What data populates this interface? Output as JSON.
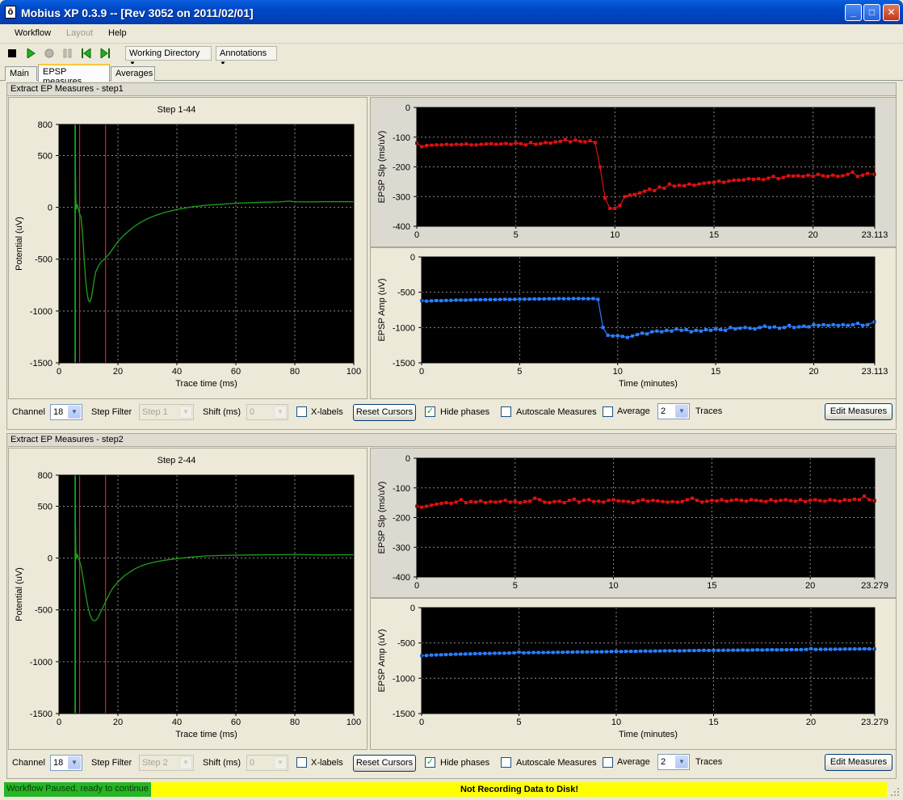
{
  "window": {
    "title": "Mobius XP 0.3.9 -- [Rev 3052 on 2011/02/01]",
    "icon": "app-logo-icon",
    "buttons": [
      "minimize-icon",
      "maximize-icon",
      "close-icon"
    ]
  },
  "menu": {
    "items": [
      "Workflow",
      "Layout",
      "Help"
    ],
    "disabled": [
      "Layout"
    ]
  },
  "toolbar": {
    "icons": [
      "stop-icon",
      "play-icon",
      "record-icon",
      "pause-icon",
      "step-back-icon",
      "step-forward-icon"
    ],
    "working_directory": "Working Directory",
    "annotations": "Annotations"
  },
  "tabs": [
    "Main",
    "EPSP measures",
    "Averages"
  ],
  "active_tab": "EPSP measures",
  "panels": [
    {
      "header": "Extract EP Measures - step1",
      "trace_title": "Step 1-44",
      "controls": {
        "channel_label": "Channel",
        "channel_value": "18",
        "step_filter_label": "Step Filter",
        "step_filter_value": "Step 1",
        "shift_label": "Shift (ms)",
        "shift_value": "0",
        "xlabels_label": "X-labels",
        "xlabels_checked": false,
        "reset_cursors": "Reset Cursors",
        "hide_phases_label": "Hide phases",
        "hide_phases_checked": true,
        "autoscale_label": "Autoscale Measures",
        "autoscale_checked": false,
        "average_label": "Average",
        "average_checked": false,
        "average_value": "2",
        "traces_label": "Traces",
        "edit_measures": "Edit Measures"
      }
    },
    {
      "header": "Extract EP Measures - step2",
      "trace_title": "Step 2-44",
      "controls": {
        "channel_label": "Channel",
        "channel_value": "18",
        "step_filter_label": "Step Filter",
        "step_filter_value": "Step 2",
        "shift_label": "Shift (ms)",
        "shift_value": "0",
        "xlabels_label": "X-labels",
        "xlabels_checked": false,
        "reset_cursors": "Reset Cursors",
        "hide_phases_label": "Hide phases",
        "hide_phases_checked": true,
        "autoscale_label": "Autoscale Measures",
        "autoscale_checked": false,
        "average_label": "Average",
        "average_checked": false,
        "average_value": "2",
        "traces_label": "Traces",
        "edit_measures": "Edit Measures"
      }
    }
  ],
  "status": {
    "left": "Workflow Paused, ready to continue",
    "right": "Not Recording Data to Disk!"
  },
  "colors": {
    "plot_bg": "#000000",
    "trace": "#1ea01e",
    "cursor_green": "#20c020",
    "cursor_red": "#e02020",
    "slope_series": "#e01010",
    "amp_series": "#2a7fff",
    "status_ok": "#26b524",
    "status_warn": "#ffff00"
  },
  "chart_data": [
    {
      "id": "trace1",
      "type": "line",
      "ylabel": "Potential (uV)",
      "xlabel": "Trace time (ms)",
      "xlim": [
        0,
        100
      ],
      "ylim": [
        -1500,
        800
      ],
      "xticks": [
        "0",
        "20",
        "40",
        "60",
        "80",
        "100"
      ],
      "yticks": [
        "800",
        "500",
        "0",
        "-500",
        "-1000",
        "-1500"
      ],
      "cursors_green": [
        5.5
      ],
      "cursors_red": [
        7,
        15.8
      ],
      "x": [
        5.5,
        5.6,
        5.7,
        5.9,
        6.2,
        6.6,
        7,
        7.5,
        8,
        8.5,
        9,
        9.5,
        10,
        10.5,
        11,
        11.5,
        12,
        12.5,
        13,
        13.5,
        14,
        14.5,
        15,
        15.5,
        16,
        17,
        18,
        19,
        20,
        22,
        24,
        26,
        28,
        30,
        33,
        36,
        40,
        45,
        50,
        55,
        60,
        65,
        70,
        75,
        78,
        80,
        85,
        90,
        95,
        100
      ],
      "y": [
        0,
        380,
        100,
        -20,
        30,
        -20,
        -60,
        -100,
        -250,
        -480,
        -680,
        -820,
        -900,
        -910,
        -870,
        -780,
        -690,
        -620,
        -590,
        -560,
        -540,
        -520,
        -510,
        -500,
        -480,
        -450,
        -410,
        -370,
        -330,
        -270,
        -220,
        -175,
        -140,
        -110,
        -75,
        -48,
        -20,
        5,
        20,
        30,
        40,
        45,
        50,
        52,
        60,
        55,
        52,
        55,
        55,
        55
      ]
    },
    {
      "id": "slope1",
      "type": "line",
      "ylabel": "EPSP Slp (ms/uV)",
      "xlabel": "",
      "xlim": [
        0,
        23.113
      ],
      "ylim": [
        -400,
        0
      ],
      "xticks": [
        "0",
        "5",
        "10",
        "15",
        "20",
        "23.113"
      ],
      "yticks": [
        "0",
        "-100",
        "-200",
        "-300",
        "-400"
      ],
      "x": [
        0,
        0.25,
        0.5,
        0.75,
        1,
        1.25,
        1.5,
        1.75,
        2,
        2.25,
        2.5,
        2.75,
        3,
        3.25,
        3.5,
        3.75,
        4,
        4.25,
        4.5,
        4.75,
        5,
        5.25,
        5.5,
        5.75,
        6,
        6.25,
        6.5,
        6.75,
        7,
        7.25,
        7.5,
        7.75,
        8,
        8.25,
        8.5,
        8.75,
        9,
        9.25,
        9.5,
        9.75,
        10,
        10.25,
        10.5,
        10.75,
        11,
        11.25,
        11.5,
        11.75,
        12,
        12.25,
        12.5,
        12.75,
        13,
        13.25,
        13.5,
        13.75,
        14,
        14.25,
        14.5,
        14.75,
        15,
        15.25,
        15.5,
        15.75,
        16,
        16.25,
        16.5,
        16.75,
        17,
        17.25,
        17.5,
        17.75,
        18,
        18.25,
        18.5,
        18.75,
        19,
        19.25,
        19.5,
        19.75,
        20,
        20.25,
        20.5,
        20.75,
        21,
        21.25,
        21.5,
        21.75,
        22,
        22.25,
        22.5,
        22.75,
        23.1
      ],
      "y": [
        -120,
        -132,
        -128,
        -127,
        -126,
        -126,
        -124,
        -126,
        -124,
        -125,
        -123,
        -126,
        -126,
        -124,
        -123,
        -122,
        -124,
        -123,
        -121,
        -124,
        -120,
        -122,
        -126,
        -118,
        -124,
        -122,
        -118,
        -120,
        -116,
        -114,
        -108,
        -116,
        -110,
        -114,
        -116,
        -112,
        -118,
        -200,
        -305,
        -340,
        -340,
        -330,
        -300,
        -295,
        -293,
        -288,
        -282,
        -275,
        -280,
        -268,
        -272,
        -258,
        -265,
        -262,
        -264,
        -258,
        -262,
        -258,
        -255,
        -253,
        -252,
        -248,
        -252,
        -248,
        -245,
        -245,
        -244,
        -240,
        -242,
        -240,
        -243,
        -238,
        -232,
        -240,
        -236,
        -230,
        -231,
        -230,
        -232,
        -228,
        -232,
        -225,
        -230,
        -232,
        -228,
        -232,
        -230,
        -225,
        -218,
        -232,
        -228,
        -222,
        -225
      ]
    },
    {
      "id": "amp1",
      "type": "line",
      "ylabel": "EPSP Amp (uV)",
      "xlabel": "Time (minutes)",
      "xlim": [
        0,
        23.113
      ],
      "ylim": [
        -1500,
        0
      ],
      "xticks": [
        "0",
        "5",
        "10",
        "15",
        "20",
        "23.113"
      ],
      "yticks": [
        "0",
        "-500",
        "-1000",
        "-1500"
      ],
      "x": [
        0,
        0.25,
        0.5,
        0.75,
        1,
        1.25,
        1.5,
        1.75,
        2,
        2.25,
        2.5,
        2.75,
        3,
        3.25,
        3.5,
        3.75,
        4,
        4.25,
        4.5,
        4.75,
        5,
        5.25,
        5.5,
        5.75,
        6,
        6.25,
        6.5,
        6.75,
        7,
        7.25,
        7.5,
        7.75,
        8,
        8.25,
        8.5,
        8.75,
        9,
        9.25,
        9.5,
        9.75,
        10,
        10.25,
        10.5,
        10.75,
        11,
        11.25,
        11.5,
        11.75,
        12,
        12.25,
        12.5,
        12.75,
        13,
        13.25,
        13.5,
        13.75,
        14,
        14.25,
        14.5,
        14.75,
        15,
        15.25,
        15.5,
        15.75,
        16,
        16.25,
        16.5,
        16.75,
        17,
        17.25,
        17.5,
        17.75,
        18,
        18.25,
        18.5,
        18.75,
        19,
        19.25,
        19.5,
        19.75,
        20,
        20.25,
        20.5,
        20.75,
        21,
        21.25,
        21.5,
        21.75,
        22,
        22.25,
        22.5,
        22.75,
        23.1
      ],
      "y": [
        -620,
        -625,
        -622,
        -618,
        -620,
        -616,
        -615,
        -612,
        -610,
        -612,
        -608,
        -606,
        -606,
        -605,
        -604,
        -603,
        -602,
        -600,
        -601,
        -600,
        -598,
        -598,
        -596,
        -595,
        -595,
        -594,
        -592,
        -593,
        -590,
        -592,
        -592,
        -590,
        -590,
        -591,
        -592,
        -590,
        -600,
        -1000,
        -1110,
        -1120,
        -1115,
        -1125,
        -1140,
        -1120,
        -1100,
        -1080,
        -1090,
        -1060,
        -1050,
        -1060,
        -1040,
        -1050,
        -1020,
        -1040,
        -1030,
        -1060,
        -1040,
        -1050,
        -1030,
        -1040,
        -1020,
        -1030,
        -1040,
        -1000,
        -1020,
        -1010,
        -1000,
        -1010,
        -1020,
        -1000,
        -980,
        -1000,
        -990,
        -1010,
        -1000,
        -970,
        -1000,
        -990,
        -980,
        -990,
        -960,
        -970,
        -960,
        -970,
        -960,
        -970,
        -960,
        -970,
        -960,
        -940,
        -970,
        -960,
        -920
      ]
    },
    {
      "id": "trace2",
      "type": "line",
      "ylabel": "Potential (uV)",
      "xlabel": "Trace time (ms)",
      "xlim": [
        0,
        100
      ],
      "ylim": [
        -1500,
        800
      ],
      "xticks": [
        "0",
        "20",
        "40",
        "60",
        "80",
        "100"
      ],
      "yticks": [
        "800",
        "500",
        "0",
        "-500",
        "-1000",
        "-1500"
      ],
      "cursors_green": [
        5.5
      ],
      "cursors_red": [
        7,
        15.8
      ],
      "x": [
        5.5,
        5.6,
        5.7,
        5.9,
        6.2,
        6.6,
        7,
        7.5,
        8,
        8.5,
        9,
        9.5,
        10,
        10.5,
        11,
        11.5,
        12,
        12.5,
        13,
        13.5,
        14,
        15,
        16,
        17,
        18,
        20,
        22,
        24,
        26,
        28,
        30,
        33,
        36,
        40,
        45,
        50,
        55,
        60,
        65,
        70,
        75,
        80,
        85,
        90,
        95,
        100
      ],
      "y": [
        0,
        350,
        90,
        -10,
        40,
        0,
        -30,
        -80,
        -160,
        -250,
        -340,
        -420,
        -490,
        -545,
        -580,
        -600,
        -605,
        -600,
        -585,
        -560,
        -530,
        -470,
        -410,
        -350,
        -300,
        -230,
        -175,
        -135,
        -100,
        -75,
        -55,
        -35,
        -20,
        -5,
        10,
        20,
        25,
        28,
        30,
        32,
        32,
        35,
        32,
        30,
        32,
        32
      ]
    },
    {
      "id": "slope2",
      "type": "line",
      "ylabel": "EPSP Slp (ms/uV)",
      "xlabel": "",
      "xlim": [
        0,
        23.279
      ],
      "ylim": [
        -400,
        0
      ],
      "xticks": [
        "0",
        "5",
        "10",
        "15",
        "20",
        "23.279"
      ],
      "yticks": [
        "0",
        "-100",
        "-200",
        "-300",
        "-400"
      ],
      "x": [
        0,
        0.25,
        0.5,
        0.75,
        1,
        1.25,
        1.5,
        1.75,
        2,
        2.25,
        2.5,
        2.75,
        3,
        3.25,
        3.5,
        3.75,
        4,
        4.25,
        4.5,
        4.75,
        5,
        5.25,
        5.5,
        5.75,
        6,
        6.25,
        6.5,
        6.75,
        7,
        7.25,
        7.5,
        7.75,
        8,
        8.25,
        8.5,
        8.75,
        9,
        9.25,
        9.5,
        9.75,
        10,
        10.25,
        10.5,
        10.75,
        11,
        11.25,
        11.5,
        11.75,
        12,
        12.25,
        12.5,
        12.75,
        13,
        13.25,
        13.5,
        13.75,
        14,
        14.25,
        14.5,
        14.75,
        15,
        15.25,
        15.5,
        15.75,
        16,
        16.25,
        16.5,
        16.75,
        17,
        17.25,
        17.5,
        17.75,
        18,
        18.25,
        18.5,
        18.75,
        19,
        19.25,
        19.5,
        19.75,
        20,
        20.25,
        20.5,
        20.75,
        21,
        21.25,
        21.5,
        21.75,
        22,
        22.25,
        22.5,
        22.75,
        23,
        23.279
      ],
      "y": [
        -162,
        -165,
        -162,
        -158,
        -155,
        -152,
        -150,
        -152,
        -148,
        -140,
        -150,
        -146,
        -148,
        -144,
        -150,
        -146,
        -148,
        -146,
        -142,
        -148,
        -145,
        -150,
        -146,
        -145,
        -135,
        -140,
        -148,
        -150,
        -146,
        -145,
        -150,
        -142,
        -138,
        -148,
        -142,
        -140,
        -146,
        -145,
        -148,
        -142,
        -140,
        -144,
        -145,
        -146,
        -150,
        -144,
        -140,
        -145,
        -142,
        -144,
        -146,
        -148,
        -146,
        -148,
        -146,
        -140,
        -135,
        -142,
        -148,
        -145,
        -142,
        -144,
        -140,
        -145,
        -142,
        -140,
        -142,
        -145,
        -140,
        -142,
        -144,
        -146,
        -140,
        -145,
        -142,
        -140,
        -143,
        -145,
        -140,
        -146,
        -142,
        -140,
        -143,
        -145,
        -140,
        -142,
        -145,
        -140,
        -142,
        -138,
        -140,
        -128,
        -140,
        -143
      ]
    },
    {
      "id": "amp2",
      "type": "line",
      "ylabel": "EPSP Amp (uV)",
      "xlabel": "Time (minutes)",
      "xlim": [
        0,
        23.279
      ],
      "ylim": [
        -1500,
        0
      ],
      "xticks": [
        "0",
        "5",
        "10",
        "15",
        "20",
        "23.279"
      ],
      "yticks": [
        "0",
        "-500",
        "-1000",
        "-1500"
      ],
      "x": [
        0,
        0.25,
        0.5,
        0.75,
        1,
        1.25,
        1.5,
        1.75,
        2,
        2.25,
        2.5,
        2.75,
        3,
        3.25,
        3.5,
        3.75,
        4,
        4.25,
        4.5,
        4.75,
        5,
        5.25,
        5.5,
        5.75,
        6,
        6.25,
        6.5,
        6.75,
        7,
        7.25,
        7.5,
        7.75,
        8,
        8.25,
        8.5,
        8.75,
        9,
        9.25,
        9.5,
        9.75,
        10,
        10.25,
        10.5,
        10.75,
        11,
        11.25,
        11.5,
        11.75,
        12,
        12.25,
        12.5,
        12.75,
        13,
        13.25,
        13.5,
        13.75,
        14,
        14.25,
        14.5,
        14.75,
        15,
        15.25,
        15.5,
        15.75,
        16,
        16.25,
        16.5,
        16.75,
        17,
        17.25,
        17.5,
        17.75,
        18,
        18.25,
        18.5,
        18.75,
        19,
        19.25,
        19.5,
        19.75,
        20,
        20.25,
        20.5,
        20.75,
        21,
        21.25,
        21.5,
        21.75,
        22,
        22.25,
        22.5,
        22.75,
        23,
        23.279
      ],
      "y": [
        -680,
        -678,
        -672,
        -670,
        -668,
        -665,
        -662,
        -660,
        -658,
        -656,
        -655,
        -652,
        -650,
        -648,
        -648,
        -646,
        -645,
        -645,
        -642,
        -640,
        -630,
        -640,
        -638,
        -636,
        -636,
        -635,
        -634,
        -634,
        -632,
        -632,
        -630,
        -630,
        -628,
        -628,
        -628,
        -626,
        -625,
        -625,
        -624,
        -622,
        -620,
        -622,
        -620,
        -618,
        -618,
        -616,
        -615,
        -616,
        -614,
        -614,
        -612,
        -612,
        -610,
        -612,
        -610,
        -608,
        -608,
        -606,
        -605,
        -606,
        -604,
        -605,
        -604,
        -603,
        -602,
        -602,
        -600,
        -602,
        -600,
        -598,
        -600,
        -598,
        -596,
        -598,
        -596,
        -596,
        -594,
        -595,
        -594,
        -592,
        -580,
        -592,
        -590,
        -590,
        -590,
        -588,
        -588,
        -586,
        -586,
        -585,
        -585,
        -584,
        -584,
        -584
      ]
    }
  ]
}
